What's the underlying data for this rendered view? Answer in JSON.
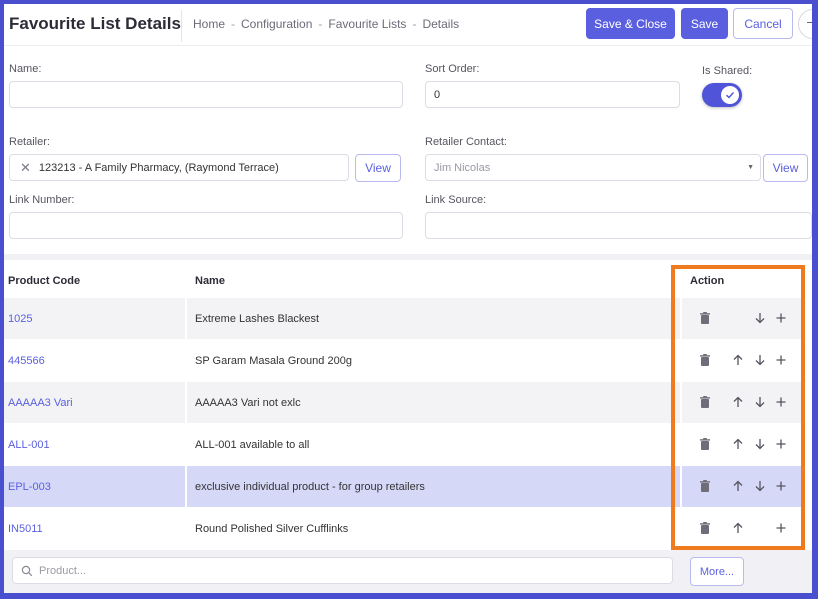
{
  "header": {
    "title": "Favourite List Details",
    "breadcrumb": [
      "Home",
      "Configuration",
      "Favourite Lists",
      "Details"
    ],
    "separator": "-",
    "save_close_label": "Save & Close",
    "save_label": "Save",
    "cancel_label": "Cancel"
  },
  "form": {
    "name_label": "Name:",
    "name_value": "",
    "sort_order_label": "Sort Order:",
    "sort_order_value": "0",
    "is_shared_label": "Is Shared:",
    "is_shared_on": true,
    "retailer_label": "Retailer:",
    "retailer_value": "123213 - A Family Pharmacy, (Raymond Terrace)",
    "retailer_view_label": "View",
    "retailer_contact_label": "Retailer Contact:",
    "retailer_contact_placeholder": "Jim Nicolas",
    "retailer_contact_view_label": "View",
    "link_number_label": "Link Number:",
    "link_number_value": "",
    "link_source_label": "Link Source:",
    "link_source_value": ""
  },
  "table": {
    "columns": [
      "Product Code",
      "Name",
      "Action"
    ],
    "rows": [
      {
        "code": "1025",
        "name": "Extreme Lashes Blackest",
        "up": false,
        "down": true
      },
      {
        "code": "445566",
        "name": "SP Garam Masala Ground 200g",
        "up": true,
        "down": true
      },
      {
        "code": "AAAAA3 Vari",
        "name": "AAAAA3 Vari not exlc",
        "up": true,
        "down": true
      },
      {
        "code": "ALL-001",
        "name": "ALL-001 available to all",
        "up": true,
        "down": true
      },
      {
        "code": "EPL-003",
        "name": "exclusive individual product - for group retailers",
        "up": true,
        "down": true
      },
      {
        "code": "IN5011",
        "name": "Round Polished Silver Cufflinks",
        "up": true,
        "down": false
      }
    ]
  },
  "footer": {
    "product_placeholder": "Product...",
    "more_label": "More..."
  },
  "colors": {
    "accent": "#5a5fe0",
    "highlight": "#f07a1e",
    "selected_row": "#d6d8f7"
  }
}
